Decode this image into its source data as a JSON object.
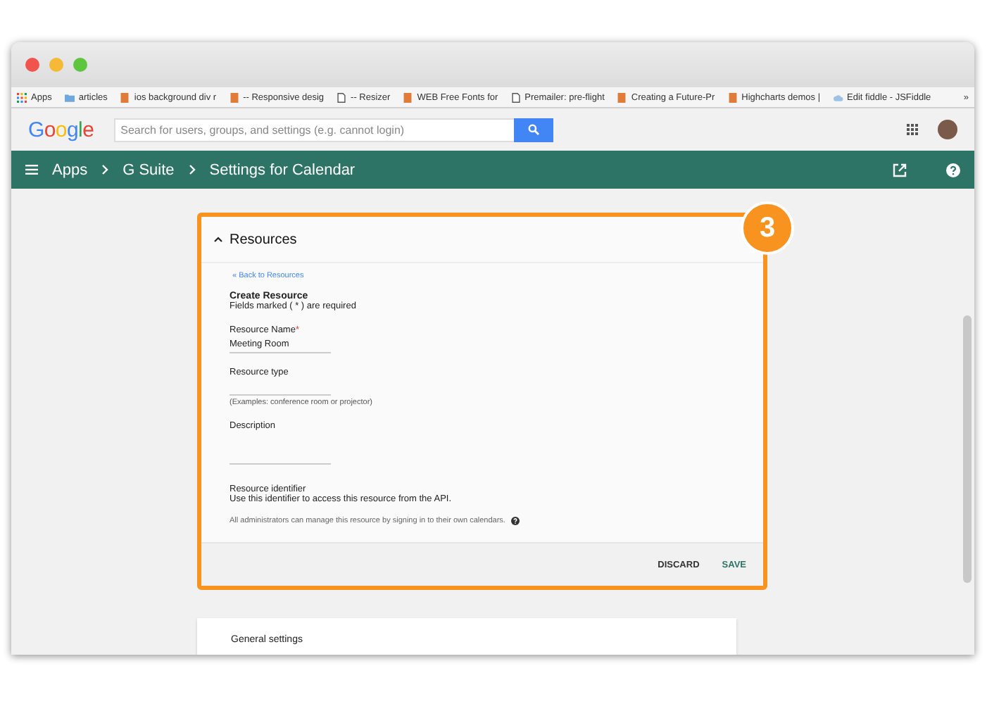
{
  "bookmarks": [
    {
      "label": "Apps",
      "kind": "apps"
    },
    {
      "label": "articles",
      "kind": "folder"
    },
    {
      "label": "ios background div r",
      "kind": "page"
    },
    {
      "label": "-- Responsive desig",
      "kind": "page"
    },
    {
      "label": "-- Resizer",
      "kind": "doc"
    },
    {
      "label": "WEB Free Fonts for",
      "kind": "page"
    },
    {
      "label": "Premailer: pre-flight",
      "kind": "doc"
    },
    {
      "label": "Creating a Future-Pr",
      "kind": "page"
    },
    {
      "label": "Highcharts demos |",
      "kind": "page"
    },
    {
      "label": "Edit fiddle - JSFiddle",
      "kind": "cloud"
    }
  ],
  "bookmarks_more": "»",
  "header": {
    "logo": "Google",
    "search": {
      "placeholder": "Search for users, groups, and settings (e.g. cannot login)"
    }
  },
  "nav": {
    "breadcrumbs": [
      "Apps",
      "G Suite",
      "Settings for Calendar"
    ]
  },
  "card": {
    "badge": "3",
    "title": "Resources",
    "expanded": true,
    "back_link": "« Back to Resources",
    "heading": "Create Resource",
    "required_note": "Fields marked ( * ) are required",
    "required_mark": "*",
    "fields": [
      {
        "kind": "input",
        "label": "Resource Name",
        "required": true,
        "value": "Meeting Room"
      },
      {
        "kind": "input",
        "label": "Resource type",
        "required": false,
        "hint": "(Examples: conference room or projector)"
      },
      {
        "kind": "textarea",
        "label": "Description",
        "required": false
      }
    ],
    "identifier": {
      "label": "Resource identifier",
      "text": "Use this identifier to access this resource from the API."
    },
    "admin_note": "All administrators can manage this resource by signing in to their own calendars.",
    "buttons": [
      {
        "label": "DISCARD",
        "kind": "secondary"
      },
      {
        "label": "SAVE",
        "kind": "primary"
      }
    ]
  },
  "next_card": {
    "title": "General settings"
  }
}
